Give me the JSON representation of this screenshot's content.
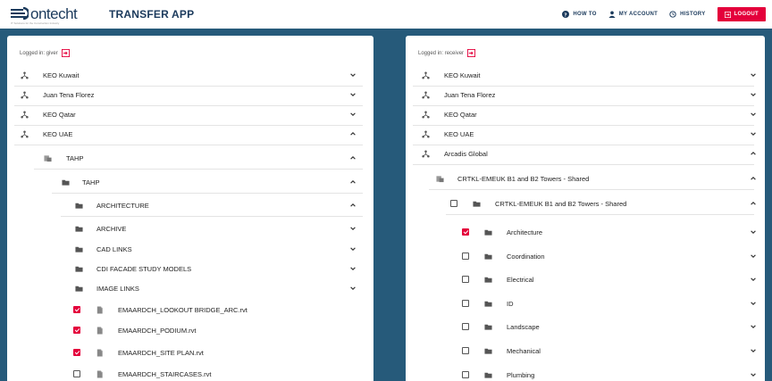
{
  "header": {
    "logo_text": "ontecht",
    "logo_sub": "IT Solutions for the Construction Industry",
    "app_title": "TRANSFER APP",
    "nav": [
      {
        "label": "HOW TO",
        "icon": "help-icon"
      },
      {
        "label": "MY ACCOUNT",
        "icon": "user-icon"
      },
      {
        "label": "HISTORY",
        "icon": "history-icon"
      }
    ],
    "logout_label": "LOGOUT"
  },
  "colors": {
    "accent": "#e4003b",
    "navy": "#1b3a5c",
    "band": "#265a7a"
  },
  "left": {
    "login_text": "Logged in: giver",
    "rows": [
      {
        "label": "KEO Kuwait",
        "icon": "hub-icon",
        "expanded": false
      },
      {
        "label": "Juan Tena Florez",
        "icon": "hub-icon",
        "expanded": false
      },
      {
        "label": "KEO Qatar",
        "icon": "hub-icon",
        "expanded": false
      },
      {
        "label": "KEO UAE",
        "icon": "hub-icon",
        "expanded": true
      },
      {
        "label": "TAHP",
        "icon": "project-icon",
        "expanded": true
      },
      {
        "label": "TAHP",
        "icon": "folder-icon",
        "expanded": true
      },
      {
        "label": "ARCHITECTURE",
        "icon": "folder-icon",
        "expanded": true
      },
      {
        "label": "ARCHIVE",
        "icon": "folder-icon",
        "expanded": false
      },
      {
        "label": "CAD LINKS",
        "icon": "folder-icon",
        "expanded": false
      },
      {
        "label": "CDI FACADE STUDY MODELS",
        "icon": "folder-icon",
        "expanded": false
      },
      {
        "label": "IMAGE LINKS",
        "icon": "folder-icon",
        "expanded": false
      },
      {
        "label": "EMAARDCH_LOOKOUT BRIDGE_ARC.rvt",
        "icon": "file-icon",
        "checked": true
      },
      {
        "label": "EMAARDCH_PODIUM.rvt",
        "icon": "file-icon",
        "checked": true
      },
      {
        "label": "EMAARDCH_SITE PLAN.rvt",
        "icon": "file-icon",
        "checked": true
      },
      {
        "label": "EMAARDCH_STAIRCASES.rvt",
        "icon": "file-icon",
        "checked": false
      }
    ]
  },
  "right": {
    "login_text": "Logged in: receiver",
    "rows": [
      {
        "label": "KEO Kuwait",
        "icon": "hub-icon",
        "expanded": false
      },
      {
        "label": "Juan Tena Florez",
        "icon": "hub-icon",
        "expanded": false
      },
      {
        "label": "KEO Qatar",
        "icon": "hub-icon",
        "expanded": false
      },
      {
        "label": "KEO UAE",
        "icon": "hub-icon",
        "expanded": false
      },
      {
        "label": "Arcadis Global",
        "icon": "hub-icon",
        "expanded": true
      },
      {
        "label": "CRTKL-EMEUK B1 and B2 Towers - Shared",
        "icon": "project-icon",
        "expanded": true
      },
      {
        "label": "CRTKL-EMEUK B1 and B2 Towers - Shared",
        "icon": "folder-icon",
        "expanded": true,
        "checked": false
      },
      {
        "label": "Architecture",
        "icon": "folder-icon",
        "expanded": false,
        "checked": true
      },
      {
        "label": "Coordination",
        "icon": "folder-icon",
        "expanded": false,
        "checked": false
      },
      {
        "label": "Electrical",
        "icon": "folder-icon",
        "expanded": false,
        "checked": false
      },
      {
        "label": "ID",
        "icon": "folder-icon",
        "expanded": false,
        "checked": false
      },
      {
        "label": "Landscape",
        "icon": "folder-icon",
        "expanded": false,
        "checked": false
      },
      {
        "label": "Mechanical",
        "icon": "folder-icon",
        "expanded": false,
        "checked": false
      },
      {
        "label": "Plumbing",
        "icon": "folder-icon",
        "expanded": false,
        "checked": false
      }
    ]
  }
}
